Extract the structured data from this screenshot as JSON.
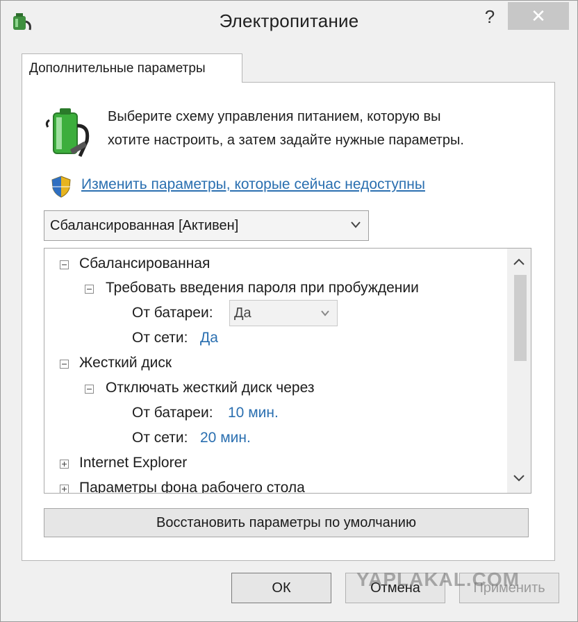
{
  "window": {
    "title": "Электропитание",
    "help_label": "?",
    "close_label": "✕"
  },
  "tab": {
    "label": "Дополнительные параметры"
  },
  "description": {
    "line1": "Выберите схему управления питанием, которую вы",
    "line2": "хотите настроить, а затем задайте нужные параметры."
  },
  "uac_link": {
    "label": "Изменить параметры, которые сейчас недоступны"
  },
  "plan_select": {
    "value": "Сбалансированная [Активен]"
  },
  "tree": {
    "balanced": "Сбалансированная",
    "password": "Требовать введения пароля при пробуждении",
    "pw_battery_label": "От батареи:",
    "pw_battery_value": "Да",
    "pw_ac_label": "От сети:",
    "pw_ac_value": "Да",
    "hdd": "Жесткий диск",
    "hdd_off": "Отключать жесткий диск через",
    "hdd_battery_label": "От батареи:",
    "hdd_battery_value": "10 мин.",
    "hdd_ac_label": "От сети:",
    "hdd_ac_value": "20 мин.",
    "ie": "Internet Explorer",
    "desktop_bg": "Параметры фона рабочего стола"
  },
  "buttons": {
    "restore": "Восстановить параметры по умолчанию",
    "ok": "ОК",
    "cancel": "Отмена",
    "apply": "Применить"
  },
  "watermark": "YAPLAKAL.COM",
  "colors": {
    "link": "#2a6fb0",
    "battery_green": "#3cae3c",
    "close_bg": "#c7c7c7"
  }
}
